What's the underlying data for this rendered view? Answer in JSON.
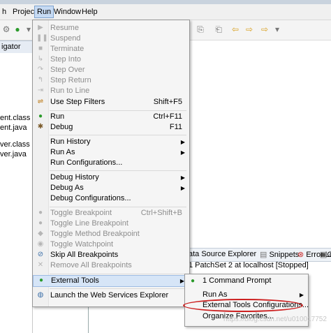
{
  "menubar": {
    "items": [
      "h",
      "Project",
      "Run",
      "Window",
      "Help"
    ]
  },
  "navigator": {
    "tab_label": "igator",
    "files": [
      "ent.class",
      "ent.java",
      "ver.class",
      "ver.java"
    ]
  },
  "run_menu": {
    "items": [
      {
        "label": "Resume",
        "accel": "",
        "enabled": false,
        "icon": "resume-icon"
      },
      {
        "label": "Suspend",
        "accel": "",
        "enabled": false,
        "icon": "suspend-icon"
      },
      {
        "label": "Terminate",
        "accel": "",
        "enabled": false,
        "icon": "terminate-icon"
      },
      {
        "label": "Step Into",
        "accel": "",
        "enabled": false,
        "icon": "step-into-icon"
      },
      {
        "label": "Step Over",
        "accel": "",
        "enabled": false,
        "icon": "step-over-icon"
      },
      {
        "label": "Step Return",
        "accel": "",
        "enabled": false,
        "icon": "step-return-icon"
      },
      {
        "label": "Run to Line",
        "accel": "",
        "enabled": false,
        "icon": "run-to-line-icon"
      },
      {
        "label": "Use Step Filters",
        "accel": "Shift+F5",
        "enabled": true,
        "icon": "step-filters-icon"
      },
      {
        "label": "Run",
        "accel": "Ctrl+F11",
        "enabled": true,
        "icon": "run-icon"
      },
      {
        "label": "Debug",
        "accel": "F11",
        "enabled": true,
        "icon": "debug-icon"
      },
      {
        "label": "Run History",
        "accel": "",
        "enabled": true,
        "submenu": true
      },
      {
        "label": "Run As",
        "accel": "",
        "enabled": true,
        "submenu": true
      },
      {
        "label": "Run Configurations...",
        "accel": "",
        "enabled": true
      },
      {
        "label": "Debug History",
        "accel": "",
        "enabled": true,
        "submenu": true
      },
      {
        "label": "Debug As",
        "accel": "",
        "enabled": true,
        "submenu": true
      },
      {
        "label": "Debug Configurations...",
        "accel": "",
        "enabled": true
      },
      {
        "label": "Toggle Breakpoint",
        "accel": "Ctrl+Shift+B",
        "enabled": false,
        "icon": "breakpoint-icon"
      },
      {
        "label": "Toggle Line Breakpoint",
        "accel": "",
        "enabled": false,
        "icon": "line-breakpoint-icon"
      },
      {
        "label": "Toggle Method Breakpoint",
        "accel": "",
        "enabled": false,
        "icon": "method-breakpoint-icon"
      },
      {
        "label": "Toggle Watchpoint",
        "accel": "",
        "enabled": false,
        "icon": "watchpoint-icon"
      },
      {
        "label": "Skip All Breakpoints",
        "accel": "",
        "enabled": true,
        "icon": "skip-breakpoints-icon"
      },
      {
        "label": "Remove All Breakpoints",
        "accel": "",
        "enabled": false,
        "icon": "remove-breakpoints-icon"
      },
      {
        "label": "External Tools",
        "accel": "",
        "enabled": true,
        "submenu": true,
        "icon": "external-tools-icon"
      },
      {
        "label": "Launch the Web Services Explorer",
        "accel": "",
        "enabled": true,
        "icon": "web-services-icon"
      }
    ]
  },
  "bottom_tabs": [
    "ata Source Explorer",
    "Snippets",
    "Error Log",
    "Co"
  ],
  "server_line": "1 PatchSet 2 at localhost  [Stopped]",
  "external_tools_submenu": {
    "items": [
      {
        "label": "1 Command Prompt",
        "icon": "external-tool-run-icon"
      },
      {
        "label": "Run As",
        "submenu": true
      },
      {
        "label": "External Tools Configurations..."
      },
      {
        "label": "Organize Favorites..."
      }
    ]
  },
  "watermark": "https://blog.csdn.net/u010017752",
  "colors": {
    "highlight": "#d6e5f7",
    "annotation_circle": "#cc2020"
  }
}
